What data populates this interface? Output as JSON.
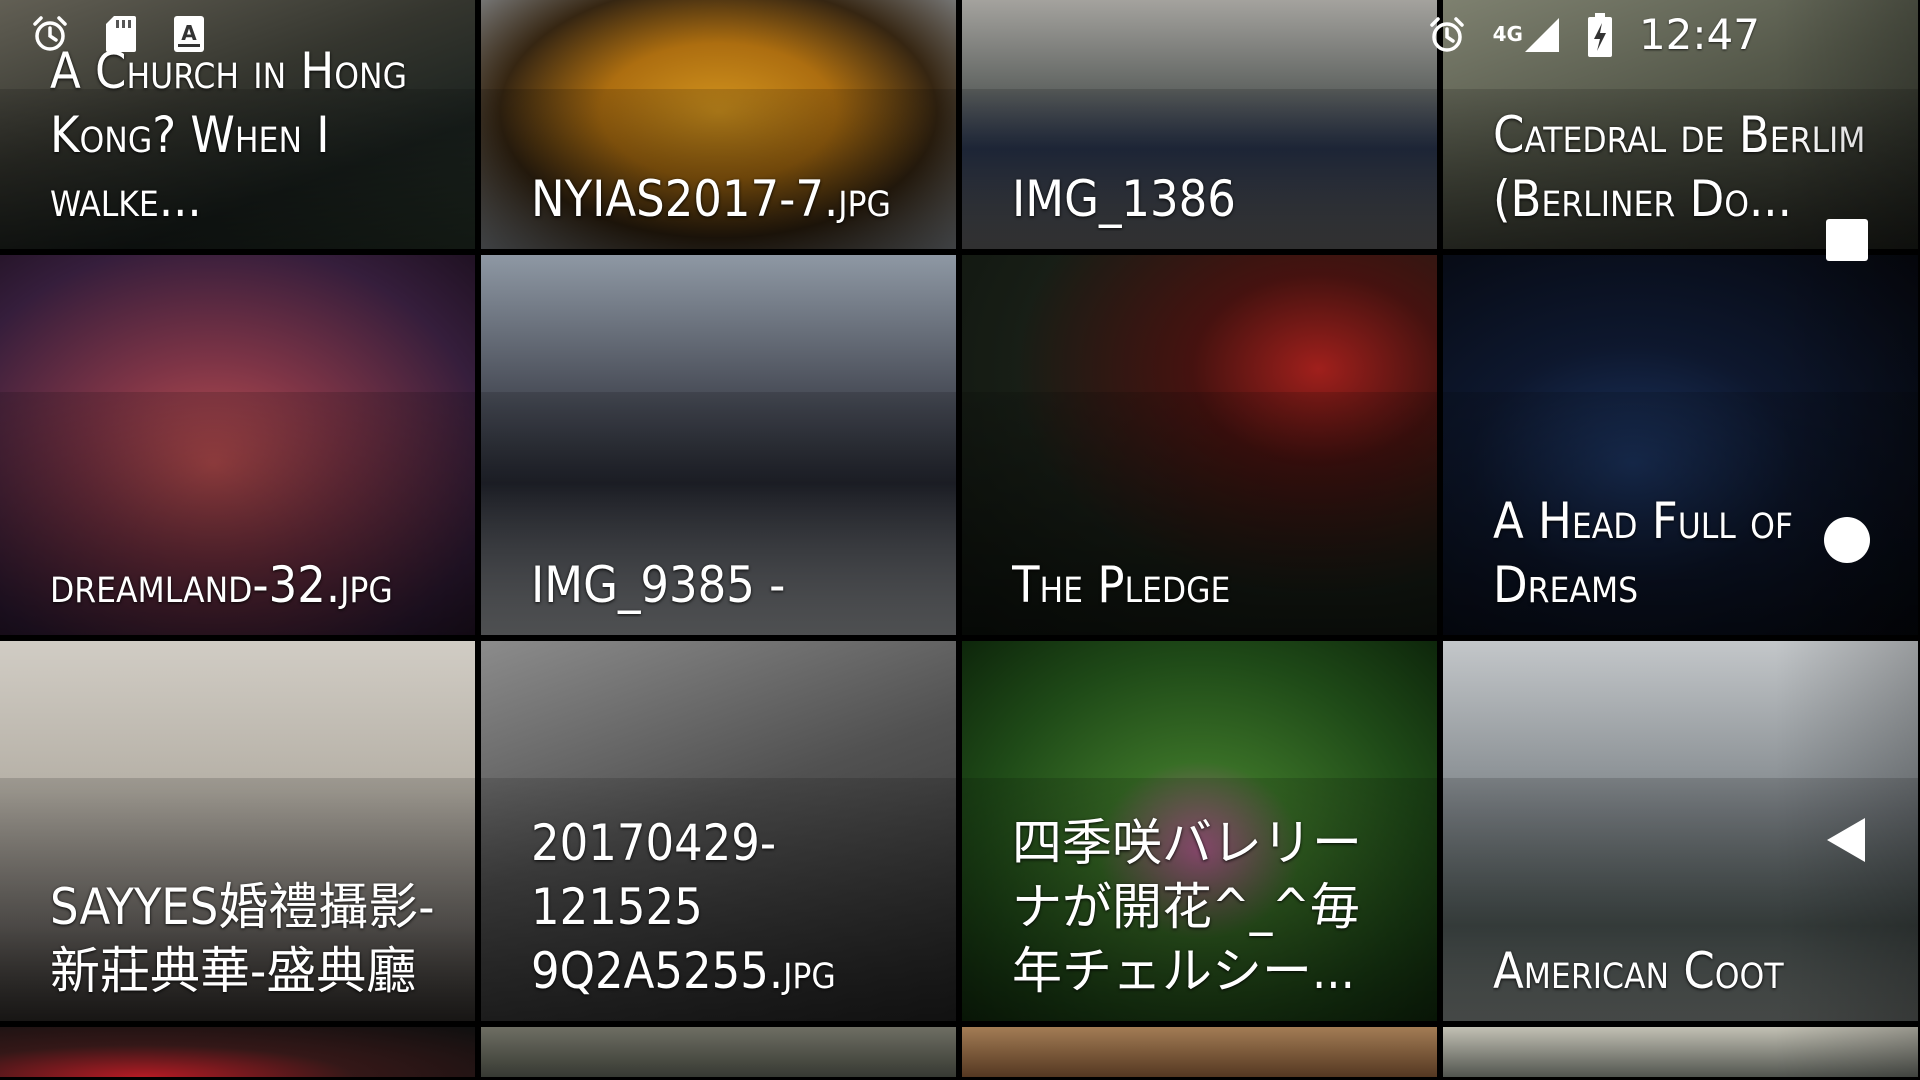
{
  "status_bar": {
    "left_icons": [
      "alarm-clock-icon",
      "sd-card-icon",
      "keyboard-input-icon"
    ],
    "right_icons": [
      "alarm-clock-icon",
      "signal-icon",
      "battery-charging-icon"
    ],
    "network_label": "4G",
    "time": "12:47"
  },
  "gallery": {
    "tiles": [
      {
        "caption": "A Church in Hong Kong? When I walke..."
      },
      {
        "caption": "NYIAS2017-7.jpg"
      },
      {
        "caption": "IMG_1386"
      },
      {
        "caption": "Catedral de Berlim (Berliner Do..."
      },
      {
        "caption": "dreamland-32.jpg"
      },
      {
        "caption": "IMG_9385 -"
      },
      {
        "caption": "The Pledge"
      },
      {
        "caption": "A Head Full of Dreams"
      },
      {
        "caption": "SAYYES婚禮攝影-新莊典華-盛典廳"
      },
      {
        "caption": "20170429-121525 9Q2A5255.jpg"
      },
      {
        "caption": "四季咲バレリーナが開花^_^毎年チェルシー..."
      },
      {
        "caption": "American Coot"
      },
      {
        "caption": ""
      },
      {
        "caption": ""
      },
      {
        "caption": ""
      },
      {
        "caption": ""
      }
    ]
  },
  "nav_bar": {
    "buttons": [
      "recents-button",
      "home-button",
      "back-button"
    ]
  }
}
